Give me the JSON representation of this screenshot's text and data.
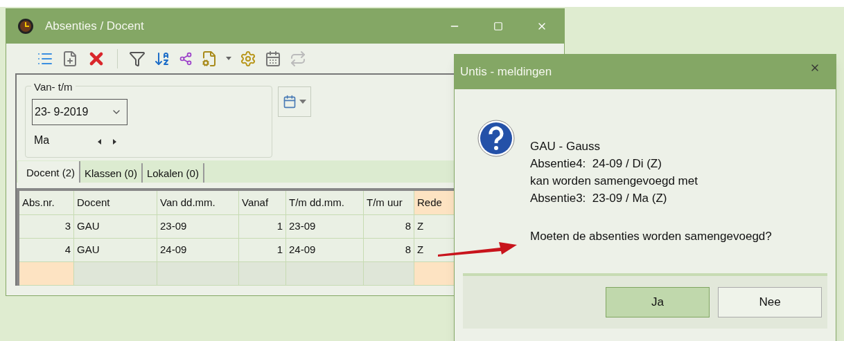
{
  "main_window": {
    "title": "Absenties / Docent",
    "toolbar": [
      {
        "kind": "list"
      },
      {
        "kind": "new"
      },
      {
        "kind": "delete"
      },
      {
        "kind": "separator"
      },
      {
        "kind": "filter"
      },
      {
        "kind": "sort"
      },
      {
        "kind": "link"
      },
      {
        "kind": "page-settings"
      },
      {
        "kind": "caret"
      },
      {
        "kind": "settings"
      },
      {
        "kind": "calendar"
      },
      {
        "kind": "transfer"
      }
    ],
    "date_group": {
      "legend": "Van- t/m",
      "date": "23- 9-2019",
      "day": "Ma"
    },
    "tabs": [
      {
        "label": "Docent (2)",
        "selected": true
      },
      {
        "label": "Klassen (0)",
        "selected": false
      },
      {
        "label": "Lokalen (0)",
        "selected": false
      }
    ],
    "table": {
      "columns": [
        {
          "label": "Abs.nr.",
          "kind": "number",
          "highlighted": false
        },
        {
          "label": "Docent",
          "kind": "text",
          "highlighted": false
        },
        {
          "label": "Van dd.mm.",
          "kind": "text",
          "highlighted": false
        },
        {
          "label": "Vanaf",
          "kind": "number",
          "highlighted": false
        },
        {
          "label": "T/m dd.mm.",
          "kind": "text",
          "highlighted": false
        },
        {
          "label": "T/m uur",
          "kind": "number",
          "highlighted": false
        },
        {
          "label": "Rede",
          "kind": "text",
          "highlighted": true
        }
      ],
      "rows": [
        [
          "3",
          "GAU",
          "23-09",
          "1",
          "23-09",
          "8",
          "Z"
        ],
        [
          "4",
          "GAU",
          "24-09",
          "1",
          "24-09",
          "8",
          "Z"
        ]
      ]
    }
  },
  "dialog": {
    "title": "Untis - meldingen",
    "lines": [
      "GAU - Gauss",
      "Absentie4:  24-09 / Di (Z)",
      "kan worden samengevoegd met",
      "Absentie3:  23-09 / Ma (Z)"
    ],
    "question": "Moeten de absenties worden samengevoegd?",
    "buttons": [
      {
        "label": "Ja",
        "default": true
      },
      {
        "label": "Nee",
        "default": false
      }
    ]
  }
}
